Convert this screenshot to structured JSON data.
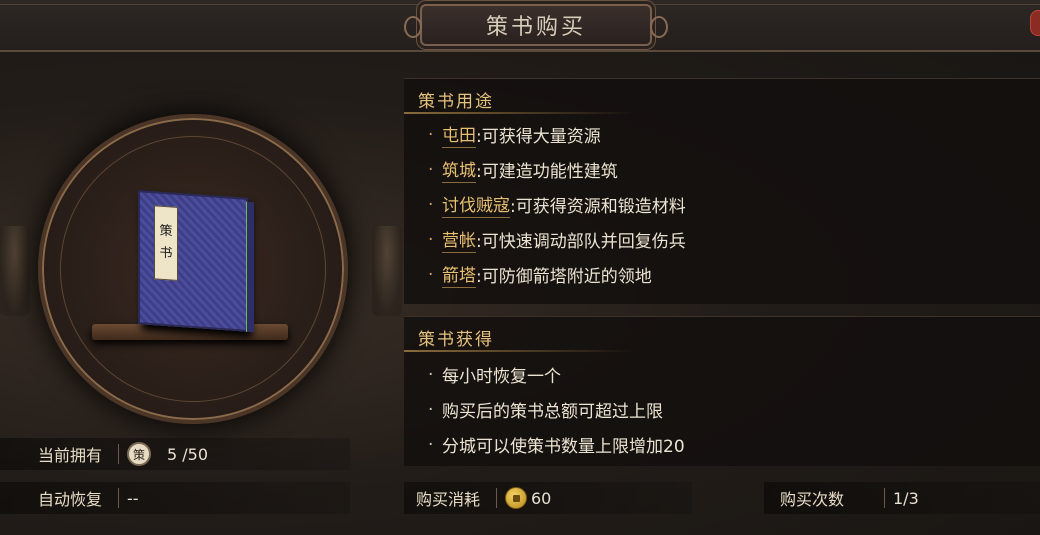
{
  "dialog": {
    "title": "策书购买"
  },
  "book": {
    "label_chars": [
      "策",
      "书"
    ]
  },
  "stats": {
    "owned_label": "当前拥有",
    "owned_icon_char": "策",
    "owned_value": "5 /50",
    "recover_label": "自动恢复",
    "recover_value": "--"
  },
  "usage": {
    "title": "策书用途",
    "items": [
      {
        "link": "屯田",
        "text": ":可获得大量资源"
      },
      {
        "link": "筑城",
        "text": ":可建造功能性建筑"
      },
      {
        "link": "讨伐贼寇",
        "text": ":可获得资源和锻造材料"
      },
      {
        "link": "营帐",
        "text": ":可快速调动部队并回复伤兵"
      },
      {
        "link": "箭塔",
        "text": ":可防御箭塔附近的领地"
      }
    ]
  },
  "obtain": {
    "title": "策书获得",
    "items": [
      "每小时恢复一个",
      "购买后的策书总额可超过上限",
      "分城可以使策书数量上限增加20"
    ]
  },
  "purchase": {
    "cost_label": "购买消耗",
    "cost_value": "60",
    "count_label": "购买次数",
    "count_value": "1/3"
  },
  "colors": {
    "accent_gold": "#e6c37c",
    "close_red": "#8a2c22"
  },
  "icons": {
    "coin": "gold-coin-icon",
    "book_badge": "ce-badge-icon"
  }
}
